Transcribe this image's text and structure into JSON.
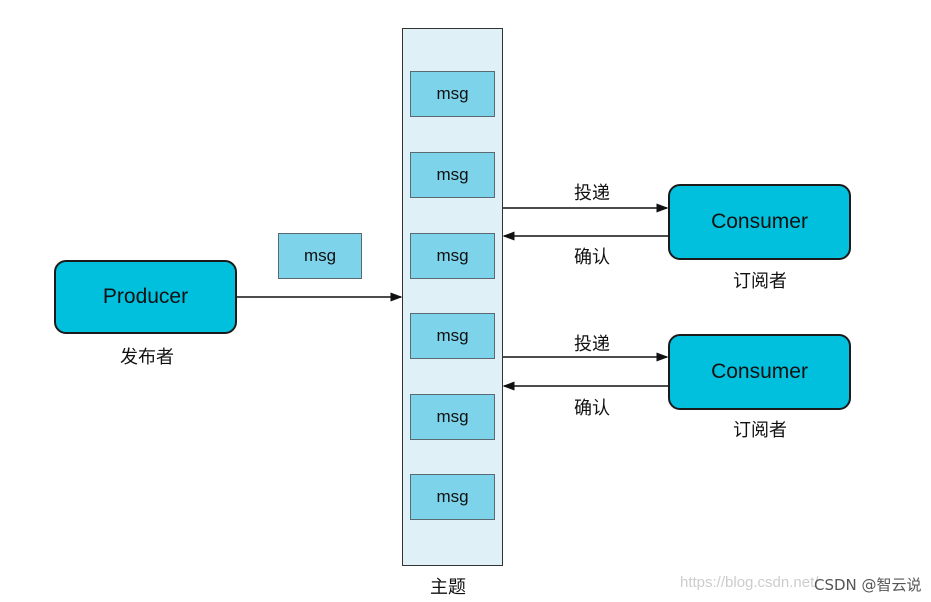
{
  "topic": {
    "label": "主题",
    "messages": [
      "msg",
      "msg",
      "msg",
      "msg",
      "msg",
      "msg"
    ]
  },
  "producer": {
    "name": "Producer",
    "label": "发布者"
  },
  "in_flight_message": "msg",
  "consumers": [
    {
      "name": "Consumer",
      "label": "订阅者",
      "deliver": "投递",
      "ack": "确认"
    },
    {
      "name": "Consumer",
      "label": "订阅者",
      "deliver": "投递",
      "ack": "确认"
    }
  ],
  "watermark": {
    "url": "https://blog.csdn.net/",
    "author": "CSDN @智云说"
  },
  "colors": {
    "node": "#00c0de",
    "msg": "#7dd3ea",
    "topic": "#dff0f6"
  }
}
